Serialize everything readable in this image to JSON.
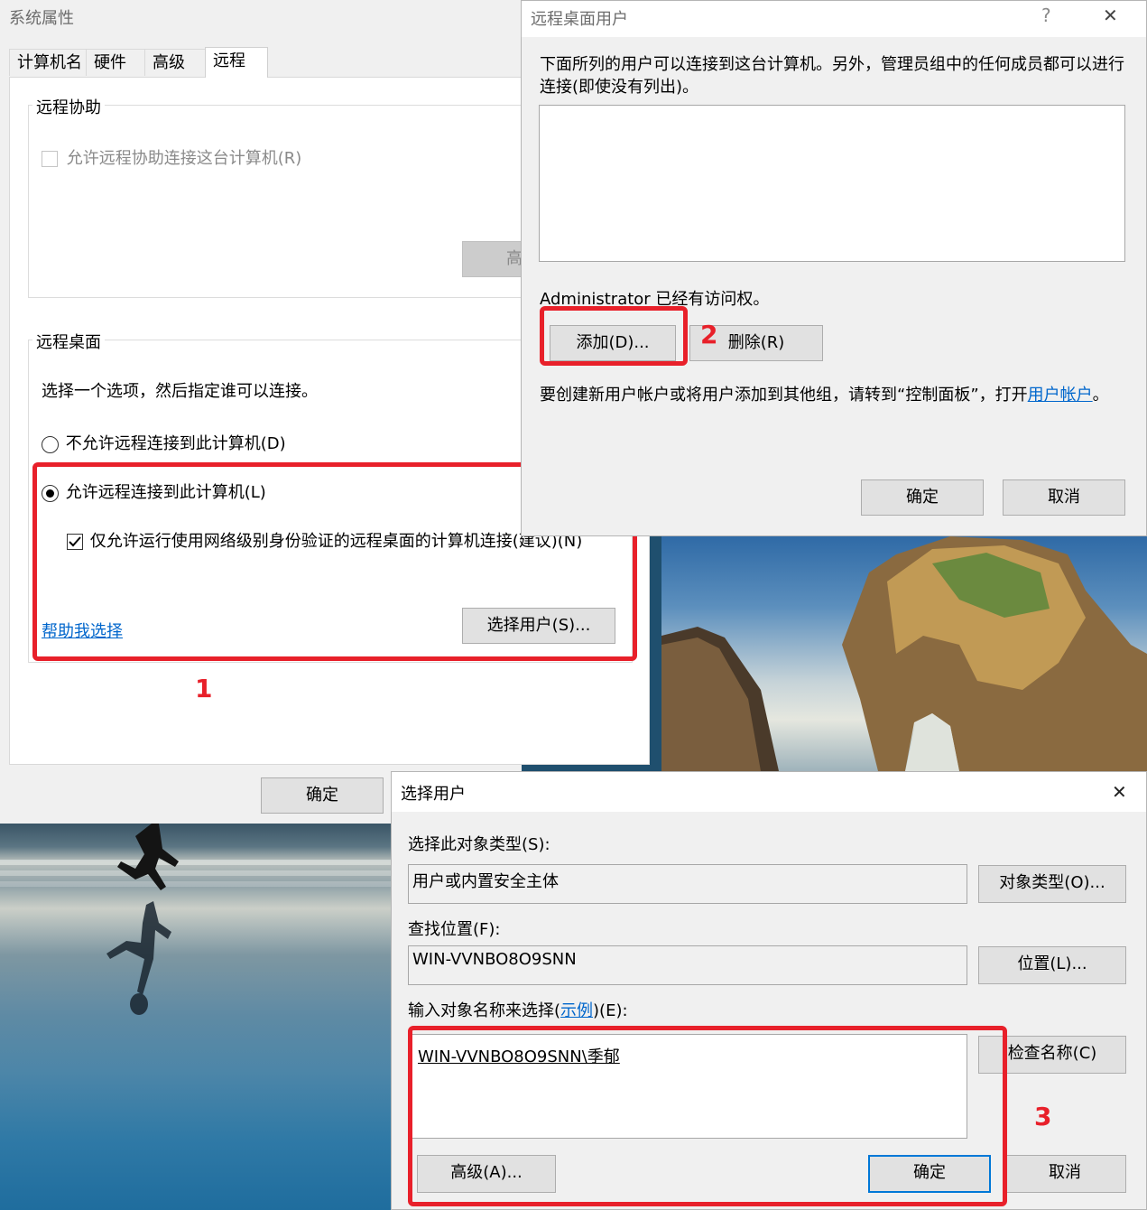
{
  "sysprops": {
    "title": "系统属性",
    "tabs": [
      "计算机名",
      "硬件",
      "高级",
      "远程"
    ],
    "remote_assist": {
      "group_label": "远程协助",
      "allow_label": "允许远程协助连接这台计算机(R)",
      "advanced_btn_partial": "高"
    },
    "remote_desktop": {
      "group_label": "远程桌面",
      "instruction": "选择一个选项，然后指定谁可以连接。",
      "option_disallow": "不允许远程连接到此计算机(D)",
      "option_allow": "允许远程连接到此计算机(L)",
      "nla_label": "仅允许运行使用网络级别身份验证的远程桌面的计算机连接(建议)(N)",
      "help_link": "帮助我选择",
      "select_users_btn": "选择用户(S)..."
    },
    "ok_btn": "确定"
  },
  "rdusers": {
    "title": "远程桌面用户",
    "help_glyph": "?",
    "close_glyph": "✕",
    "description": "下面所列的用户可以连接到这台计算机。另外，管理员组中的任何成员都可以进行连接(即使没有列出)。",
    "access_note": "Administrator 已经有访问权。",
    "add_btn": "添加(D)...",
    "remove_btn": "删除(R)",
    "footer_prefix": "要创建新用户帐户或将用户添加到其他组，请转到“控制面板”，打开",
    "footer_link": "用户帐户",
    "footer_suffix": "。",
    "ok_btn": "确定",
    "cancel_btn": "取消"
  },
  "selusers": {
    "title": "选择用户",
    "close_glyph": "✕",
    "object_type_label": "选择此对象类型(S):",
    "object_type_value": "用户或内置安全主体",
    "object_type_btn": "对象类型(O)...",
    "location_label": "查找位置(F):",
    "location_value": "WIN-VVNBO8O9SNN",
    "location_btn": "位置(L)...",
    "enter_label_prefix": "输入对象名称来选择(",
    "enter_label_link": "示例",
    "enter_label_suffix": ")(E):",
    "enter_value": "WIN-VVNBO8O9SNN\\季郁",
    "check_names_btn": "检查名称(C)",
    "advanced_btn": "高级(A)...",
    "ok_btn": "确定",
    "cancel_btn": "取消"
  },
  "annotations": {
    "step1": "1",
    "step2": "2",
    "step3": "3"
  },
  "colors": {
    "highlight": "#e8202a",
    "link": "#0066cc",
    "focus": "#0078d7"
  }
}
